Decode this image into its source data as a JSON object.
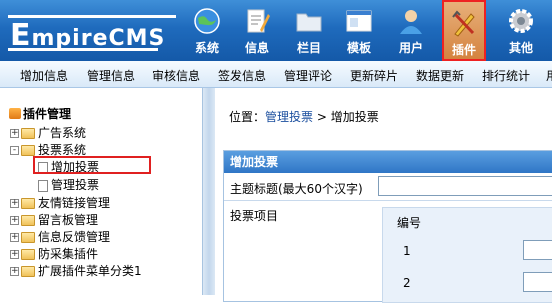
{
  "logo": {
    "first": "E",
    "rest": "mpireCMS"
  },
  "modules": [
    {
      "label": "系统",
      "icon": "globe-icon"
    },
    {
      "label": "信息",
      "icon": "edit-document-icon"
    },
    {
      "label": "栏目",
      "icon": "folder-icon"
    },
    {
      "label": "模板",
      "icon": "window-template-icon"
    },
    {
      "label": "用户",
      "icon": "user-icon"
    },
    {
      "label": "插件",
      "icon": "tools-icon",
      "active": true
    },
    {
      "label": "其他",
      "icon": "gear-icon"
    }
  ],
  "subnav": [
    "增加信息",
    "管理信息",
    "审核信息",
    "签发信息",
    "管理评论",
    "更新碎片",
    "数据更新",
    "排行统计",
    "用"
  ],
  "tree": {
    "title": "插件管理",
    "items": [
      {
        "label": "广告系统",
        "type": "folder",
        "expander": "+"
      },
      {
        "label": "投票系统",
        "type": "folder",
        "expander": "-"
      },
      {
        "label": "增加投票",
        "type": "doc",
        "selected": true
      },
      {
        "label": "管理投票",
        "type": "doc"
      },
      {
        "label": "友情链接管理",
        "type": "folder",
        "expander": "+"
      },
      {
        "label": "留言板管理",
        "type": "folder",
        "expander": "+"
      },
      {
        "label": "信息反馈管理",
        "type": "folder",
        "expander": "+"
      },
      {
        "label": "防采集插件",
        "type": "folder",
        "expander": "+"
      },
      {
        "label": "扩展插件菜单分类1",
        "type": "folder",
        "expander": "+"
      }
    ]
  },
  "breadcrumb": {
    "prefix": "位置：",
    "link": "管理投票",
    "sep": " > ",
    "current": "增加投票"
  },
  "form": {
    "header": "增加投票",
    "title_label": "主题标题(最大60个汉字)",
    "title_value": "",
    "items_label": "投票项目",
    "col_header": "编号",
    "rows": [
      "1",
      "2"
    ]
  },
  "colors": {
    "header_blue": "#1f6bbd",
    "highlight_red": "#e02020",
    "link_blue": "#1b4e9e"
  }
}
